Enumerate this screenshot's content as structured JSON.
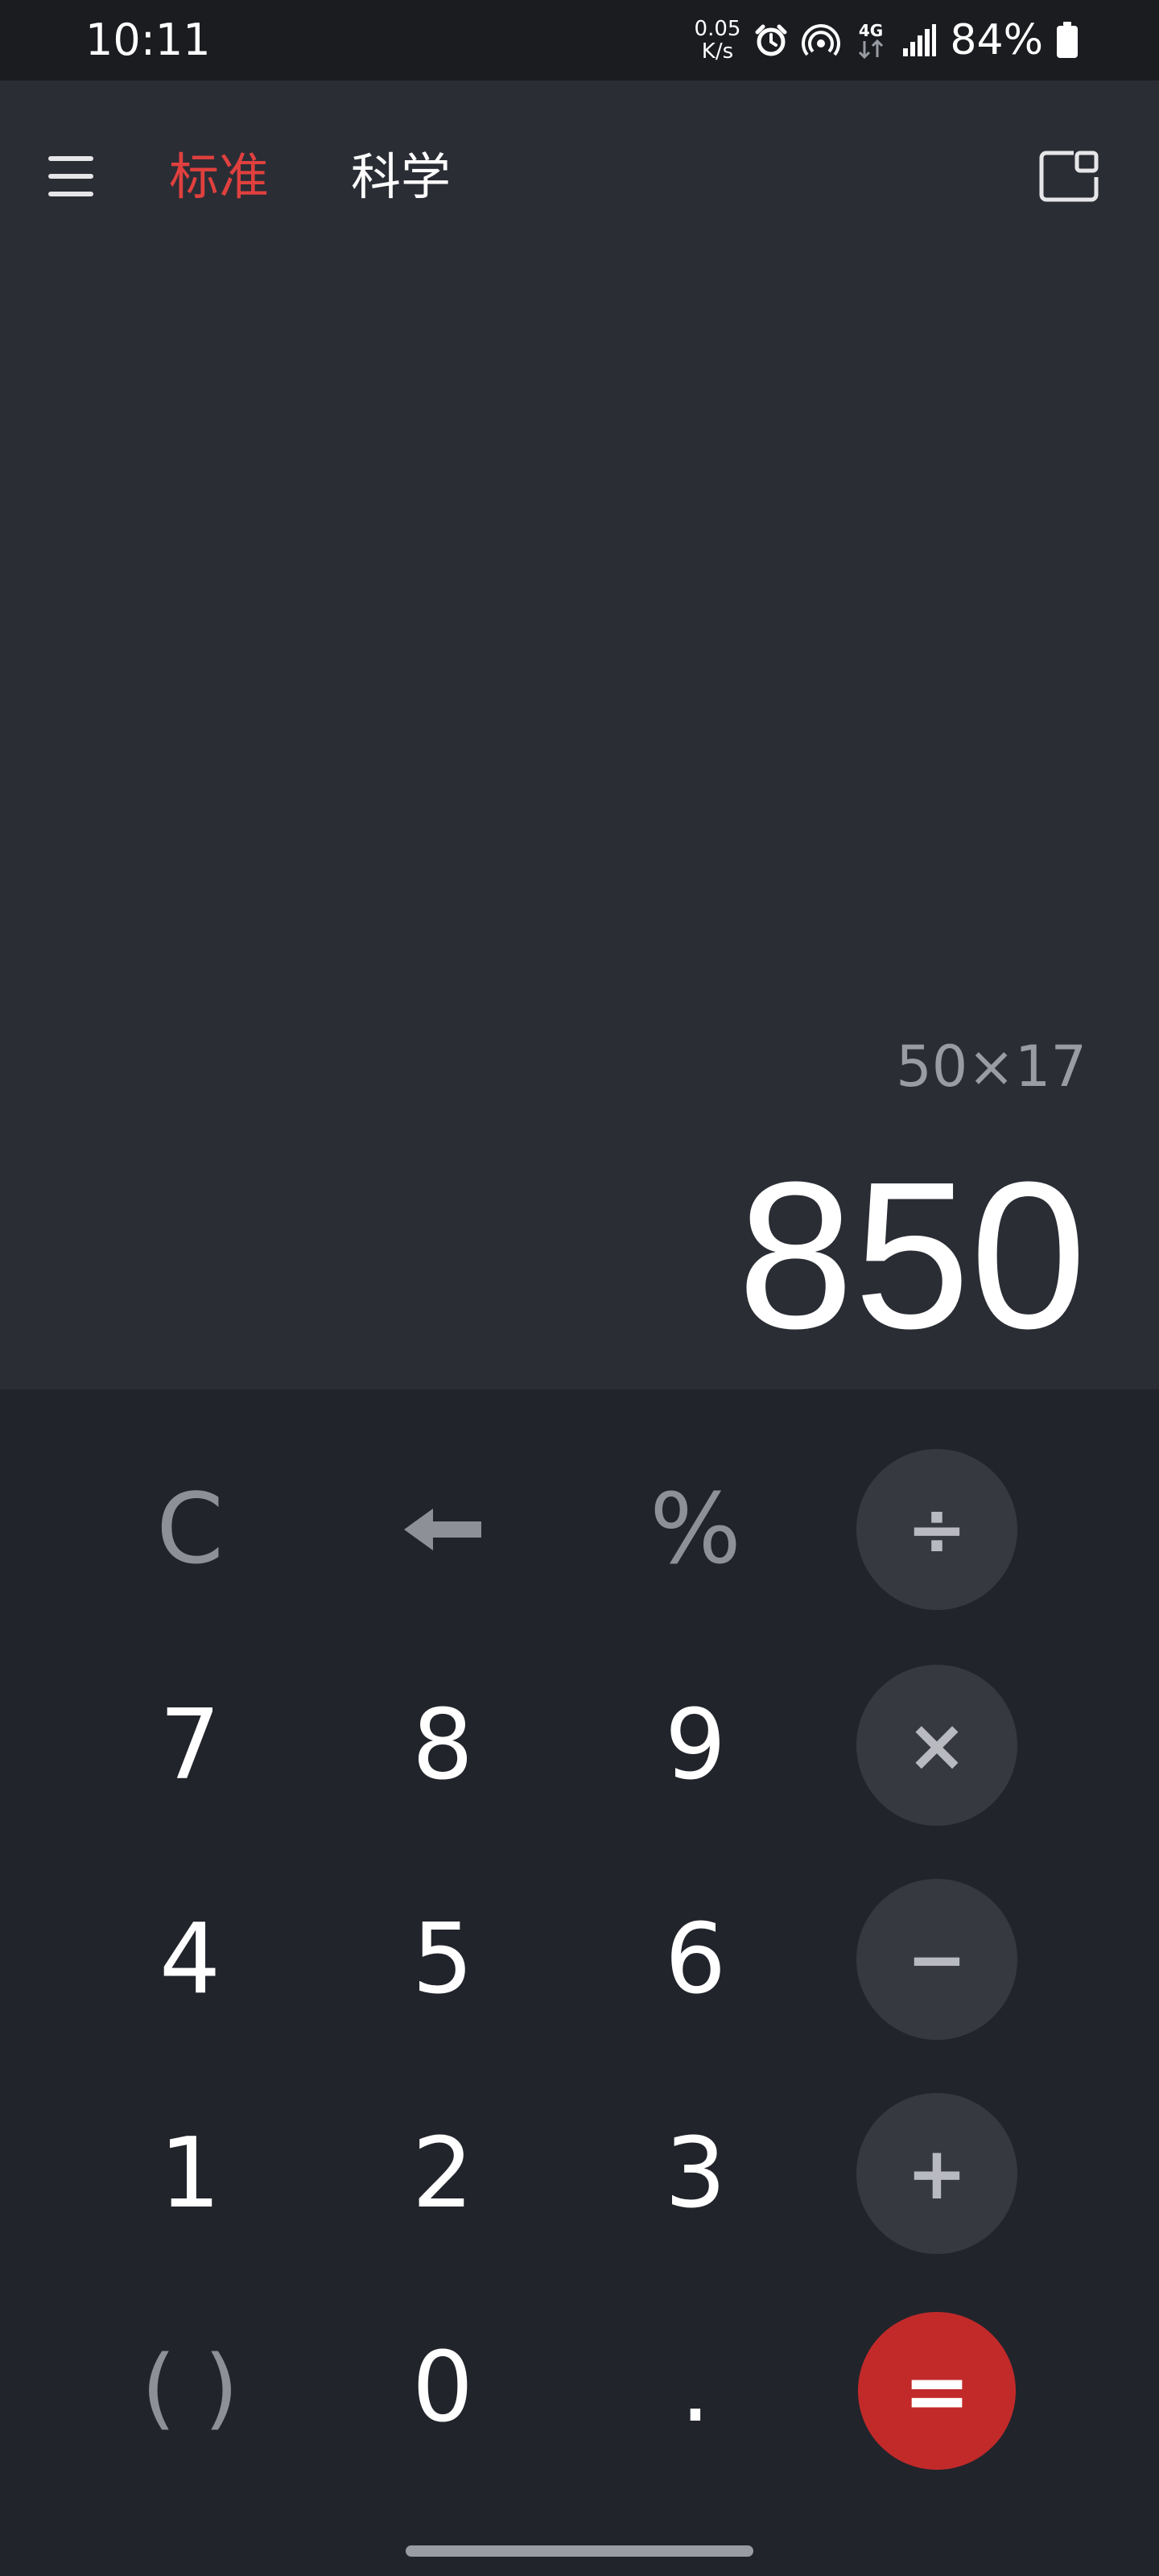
{
  "status_bar": {
    "time": "10:11",
    "net_speed_value": "0.05",
    "net_speed_unit": "K/s",
    "network_type": "4G",
    "battery_percent": "84%"
  },
  "header": {
    "tabs": [
      {
        "label": "标准",
        "active": true
      },
      {
        "label": "科学",
        "active": false
      }
    ]
  },
  "display": {
    "expression": "50×17",
    "result": "850"
  },
  "keypad": {
    "row1": [
      "C",
      "←",
      "%",
      "÷"
    ],
    "row2": [
      "7",
      "8",
      "9",
      "×"
    ],
    "row3": [
      "4",
      "5",
      "6",
      "−"
    ],
    "row4": [
      "1",
      "2",
      "3",
      "+"
    ],
    "row5": [
      "( )",
      "0",
      ".",
      "="
    ]
  },
  "colors": {
    "accent": "#e0403e",
    "equals_button": "#c22a2a",
    "display_bg": "#2b2d35",
    "keypad_bg": "#22242b",
    "operator_bg": "#363940"
  },
  "icons": [
    "menu-icon",
    "pip-window-icon",
    "alarm-icon",
    "hotspot-icon",
    "signal-icon",
    "battery-icon",
    "backspace-icon"
  ]
}
